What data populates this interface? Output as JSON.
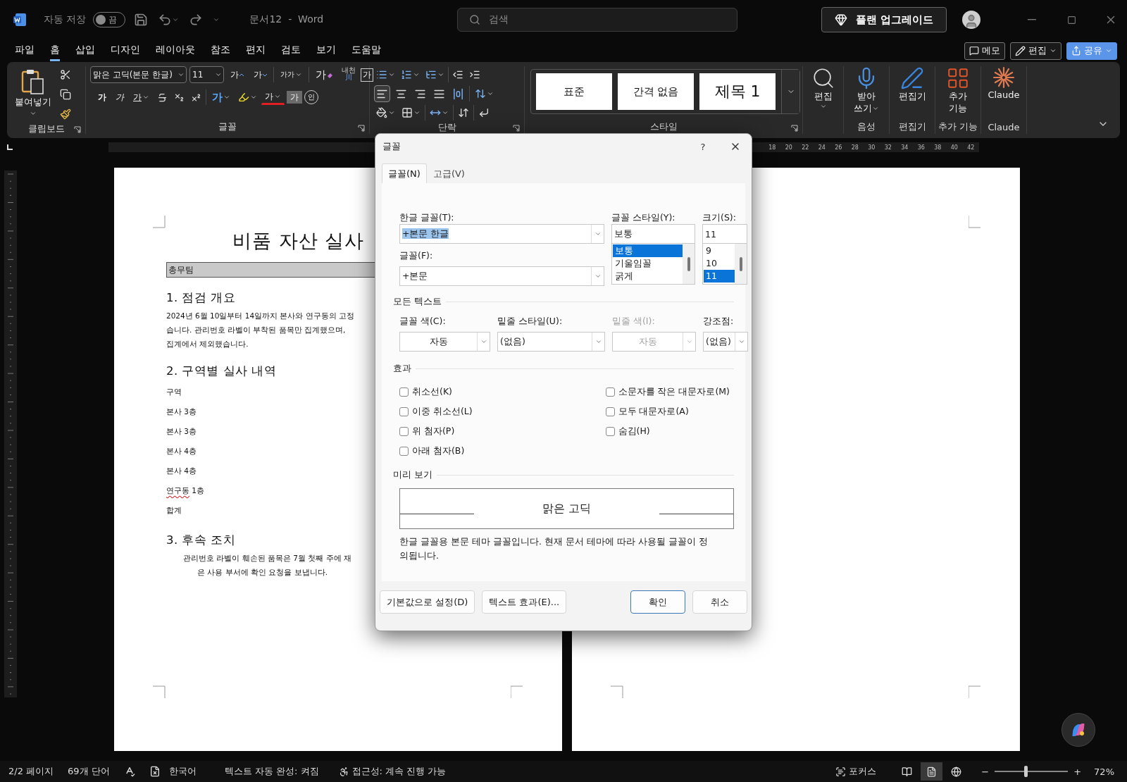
{
  "titlebar": {
    "autosave_label": "자동 저장",
    "autosave": {
      "label": "끔",
      "on": false
    },
    "title": "문서12  -  Word",
    "search": {
      "placeholder": "검색"
    },
    "upgrade": "플랜 업그레이드"
  },
  "menu_tabs": [
    {
      "label": "파일",
      "selected": false
    },
    {
      "label": "홈",
      "selected": true
    },
    {
      "label": "삽입",
      "selected": false
    },
    {
      "label": "디자인",
      "selected": false
    },
    {
      "label": "레이아웃",
      "selected": false
    },
    {
      "label": "참조",
      "selected": false
    },
    {
      "label": "편지",
      "selected": false
    },
    {
      "label": "검토",
      "selected": false
    },
    {
      "label": "보기",
      "selected": false
    },
    {
      "label": "도움말",
      "selected": false
    }
  ],
  "actions": [
    {
      "kind": "comment",
      "label": "메모"
    },
    {
      "kind": "edit",
      "label": "편집"
    },
    {
      "kind": "share",
      "label": "공유"
    }
  ],
  "ribbon": {
    "clipboard": {
      "paste": "붙여넣기",
      "label": "클립보드"
    },
    "font": {
      "name": "맑은 고딕(본문 한글)",
      "size": "11",
      "label": "글꼴",
      "row1": [
        {
          "kind": "grow",
          "text": "가"
        },
        {
          "kind": "shrink",
          "text": "가"
        },
        {
          "kind": "case",
          "text": "가가"
        },
        {
          "kind": "clear",
          "text": "가"
        },
        {
          "kind": "phonetic",
          "text": "내천",
          "sub": "川"
        },
        {
          "kind": "enclose",
          "text": "가"
        }
      ],
      "row2": [
        {
          "kind": "bold",
          "text": "가"
        },
        {
          "kind": "italic",
          "text": "가"
        },
        {
          "kind": "underline",
          "text": "가"
        },
        {
          "kind": "strike"
        },
        {
          "kind": "sub"
        },
        {
          "kind": "sup"
        },
        {
          "kind": "effect",
          "text": "가"
        },
        {
          "kind": "highlight"
        },
        {
          "kind": "color",
          "text": "가"
        },
        {
          "kind": "shade",
          "text": "가"
        },
        {
          "kind": "circle",
          "text": "인"
        }
      ]
    },
    "paragraph": {
      "label": "단락",
      "alignment": [
        {
          "kind": "left",
          "selected": true
        },
        {
          "kind": "center",
          "selected": false
        },
        {
          "kind": "right",
          "selected": false
        },
        {
          "kind": "justify",
          "selected": false
        },
        {
          "kind": "distribute",
          "selected": false
        }
      ]
    },
    "styles": {
      "label": "스타일",
      "items": [
        {
          "text": "표준",
          "kind": "normal"
        },
        {
          "text": "간격 없음",
          "kind": "normal"
        },
        {
          "text": "제목 1",
          "kind": "heading"
        }
      ]
    },
    "tools": [
      {
        "kind": "find",
        "lines": [
          "편집"
        ]
      },
      {
        "kind": "dictate",
        "lines": [
          "받아",
          "쓰기"
        ],
        "group": "음성"
      },
      {
        "kind": "editor",
        "lines": [
          "편집기"
        ],
        "group": "편집기"
      },
      {
        "kind": "addins",
        "lines": [
          "추가",
          "기능"
        ],
        "group": "추가 기능"
      },
      {
        "kind": "claude",
        "lines": [
          "Claude"
        ],
        "group": "Claude"
      }
    ]
  },
  "ruler": {
    "labels": [
      "18",
      "20",
      "22",
      "24",
      "26",
      "28",
      "30",
      "32",
      "34",
      "36",
      "38",
      "40",
      "42"
    ]
  },
  "document": {
    "title": "비품 자산 실사",
    "team": "총무팀",
    "blocks": [
      {
        "kind": "heading",
        "text": "1. 점검 개요"
      },
      {
        "kind": "body",
        "lines": [
          "2024년 6월 10일부터 14일까지 본사와 연구동의 고정",
          "습니다. 관리번호 라벨이 부착된 품목만 집계했으며,",
          "집계에서 제외했습니다."
        ]
      },
      {
        "kind": "heading",
        "text": "2. 구역별 실사 내역"
      },
      {
        "kind": "item",
        "text": "구역"
      },
      {
        "kind": "item",
        "text": "본사 3층"
      },
      {
        "kind": "item",
        "text": "본사 3층"
      },
      {
        "kind": "item",
        "text": "본사 4층"
      },
      {
        "kind": "item",
        "text": "본사 4층"
      },
      {
        "kind": "item",
        "flagged": "연구동",
        "text": "1층"
      },
      {
        "kind": "item",
        "text": "합계"
      },
      {
        "kind": "heading",
        "text": "3. 후속 조치"
      },
      {
        "kind": "indented",
        "lines": [
          "관리번호 라벨이 훼손된 품목은 7월 첫째 주에 재",
          "은 사용 부서에 확인 요청을 보냅니다."
        ]
      }
    ]
  },
  "dialog": {
    "title": "글꼴",
    "help": "?",
    "tabs": [
      {
        "label": "글꼴(N)",
        "selected": true
      },
      {
        "label": "고급(V)",
        "selected": false
      }
    ],
    "korean_font": {
      "label": "한글 글꼴(T):",
      "value": "+본문 한글",
      "text_selected": true
    },
    "font": {
      "label": "글꼴(F):",
      "value": "+본문"
    },
    "style": {
      "label": "글꼴 스타일(Y):",
      "value": "보통",
      "options": [
        {
          "text": "보통",
          "selected": true
        },
        {
          "text": "기울임꼴",
          "selected": false
        },
        {
          "text": "굵게",
          "selected": false
        }
      ]
    },
    "size": {
      "label": "크기(S):",
      "value": "11",
      "options": [
        {
          "text": "9",
          "selected": false
        },
        {
          "text": "10",
          "selected": false
        },
        {
          "text": "11",
          "selected": true
        }
      ]
    },
    "all_text": {
      "title": "모든 텍스트",
      "fields": [
        {
          "label": "글꼴 색(C):",
          "value": "자동",
          "kind": "center",
          "disabled": false
        },
        {
          "label": "밑줄 스타일(U):",
          "value": "(없음)",
          "kind": "left",
          "disabled": false
        },
        {
          "label": "밑줄 색(I):",
          "value": "자동",
          "kind": "center",
          "disabled": true
        },
        {
          "label": "강조점:",
          "value": "(없음)",
          "kind": "left",
          "disabled": false
        }
      ]
    },
    "effects": {
      "title": "효과",
      "left": [
        {
          "label": "취소선(K)",
          "checked": false
        },
        {
          "label": "이중 취소선(L)",
          "checked": false
        },
        {
          "label": "위 첨자(P)",
          "checked": false
        },
        {
          "label": "아래 첨자(B)",
          "checked": false
        }
      ],
      "right": [
        {
          "label": "소문자를 작은 대문자로(M)",
          "checked": false
        },
        {
          "label": "모두 대문자로(A)",
          "checked": false
        },
        {
          "label": "숨김(H)",
          "checked": false
        }
      ]
    },
    "preview": {
      "title": "미리 보기",
      "sample": "맑은 고딕",
      "description": "한글 글꼴용 본문 테마 글꼴입니다. 현재 문서 테마에 따라 사용될 글꼴이 정의됩니다."
    },
    "buttons": [
      {
        "label": "기본값으로 설정(D)",
        "kind": "left",
        "default": false
      },
      {
        "label": "텍스트 효과(E)...",
        "kind": "left",
        "default": false
      },
      {
        "label": "확인",
        "kind": "right",
        "default": true
      },
      {
        "label": "취소",
        "kind": "right",
        "default": false
      }
    ]
  },
  "status_bar": {
    "pages": "2/2 페이지",
    "words": "69개 단어",
    "language": "한국어",
    "autocomplete": "텍스트 자동 완성: 켜짐",
    "accessibility": "접근성: 계속 진행 가능",
    "focus": "포커스",
    "views": [
      {
        "kind": "read",
        "selected": false
      },
      {
        "kind": "print",
        "selected": true
      },
      {
        "kind": "web",
        "selected": false
      }
    ],
    "zoom": {
      "minus": "−",
      "plus": "+",
      "level": 0.4,
      "reading": "72%"
    }
  }
}
